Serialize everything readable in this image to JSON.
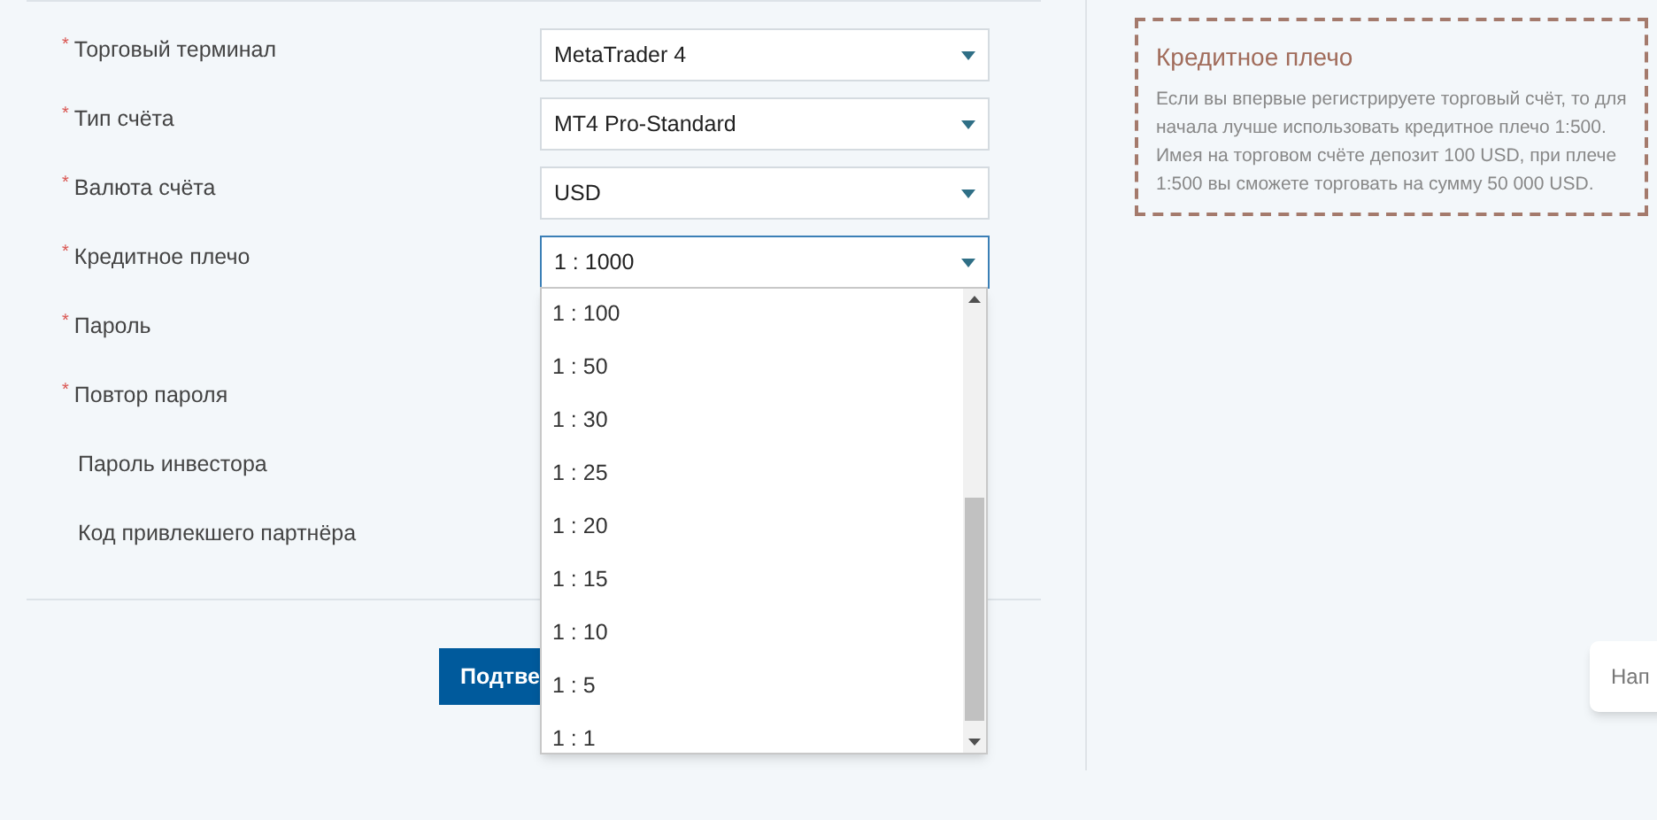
{
  "form": {
    "fields": [
      {
        "label": "Торговый терминал",
        "required_mark": "*",
        "value": "MetaTrader 4",
        "focused": false
      },
      {
        "label": "Тип счёта",
        "required_mark": "*",
        "value": "MT4 Pro-Standard",
        "focused": false
      },
      {
        "label": "Валюта счёта",
        "required_mark": "*",
        "value": "USD",
        "focused": false
      },
      {
        "label": "Кредитное плечо",
        "required_mark": "*",
        "value": "1 : 1000",
        "focused": true
      },
      {
        "label": "Пароль",
        "required_mark": "*"
      },
      {
        "label": "Повтор пароля",
        "required_mark": "*"
      },
      {
        "label": "Пароль инвестора"
      },
      {
        "label": "Код привлекшего партнёра"
      }
    ],
    "dropdown": {
      "options": [
        "1 : 100",
        "1 : 50",
        "1 : 30",
        "1 : 25",
        "1 : 20",
        "1 : 15",
        "1 : 10",
        "1 : 5",
        "1 : 1"
      ]
    },
    "submit_button": "Подтве"
  },
  "info_box": {
    "title": "Кредитное плечо",
    "text": "Если вы впервые регистрируете торговый счёт, то для начала лучше использовать кредитное плечо 1:500. Имея на торговом счёте депозит 100 USD, при плече 1:500 вы сможете торговать на сумму 50 000 USD."
  },
  "chat_widget": {
    "text": "Нап"
  }
}
